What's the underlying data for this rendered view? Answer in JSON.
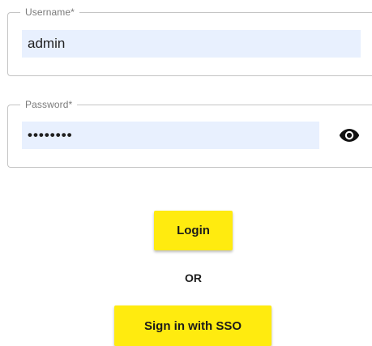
{
  "username": {
    "label": "Username*",
    "value": "admin"
  },
  "password": {
    "label": "Password*",
    "value": "••••••••",
    "toggle_icon": "eye-icon"
  },
  "actions": {
    "login_label": "Login",
    "separator": "OR",
    "sso_label": "Sign in with SSO"
  },
  "colors": {
    "button_bg": "#ffeb0f",
    "input_fill": "#e8f0fe",
    "outline": "#c4c4c4"
  }
}
